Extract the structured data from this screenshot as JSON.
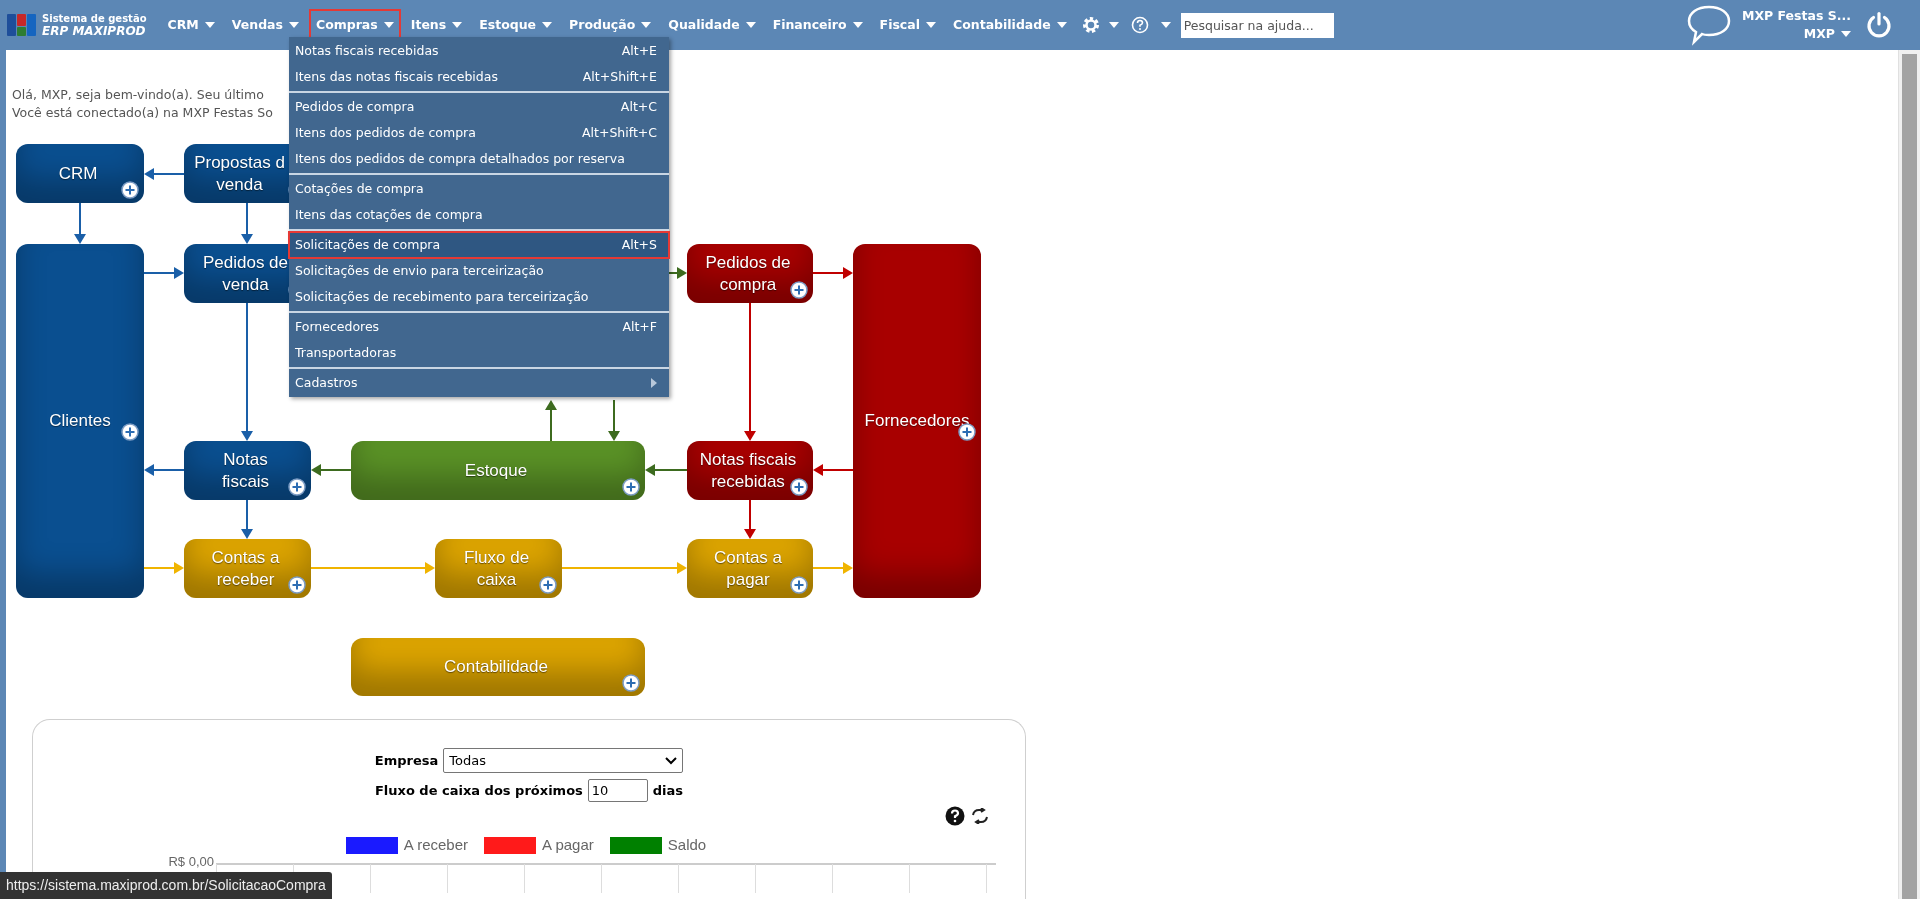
{
  "header": {
    "logo": {
      "line1": "Sistema de gestão",
      "line2": "ERP MAXIPROD"
    },
    "nav": [
      {
        "label": "CRM",
        "selected": false
      },
      {
        "label": "Vendas",
        "selected": false
      },
      {
        "label": "Compras",
        "selected": true
      },
      {
        "label": "Itens",
        "selected": false
      },
      {
        "label": "Estoque",
        "selected": false
      },
      {
        "label": "Produção",
        "selected": false
      },
      {
        "label": "Qualidade",
        "selected": false
      },
      {
        "label": "Financeiro",
        "selected": false
      },
      {
        "label": "Fiscal",
        "selected": false
      },
      {
        "label": "Contabilidade",
        "selected": false
      }
    ],
    "search": {
      "placeholder": "Pesquisar na ajuda..."
    },
    "user": {
      "company": "MXP Festas S...",
      "name": "MXP"
    }
  },
  "menu": {
    "groups": [
      [
        {
          "label": "Notas fiscais recebidas",
          "shortcut": "Alt+E",
          "selected": false,
          "has_submenu": false
        },
        {
          "label": "Itens das notas fiscais recebidas",
          "shortcut": "Alt+Shift+E",
          "selected": false,
          "has_submenu": false
        }
      ],
      [
        {
          "label": "Pedidos de compra",
          "shortcut": "Alt+C",
          "selected": false,
          "has_submenu": false
        },
        {
          "label": "Itens dos pedidos de compra",
          "shortcut": "Alt+Shift+C",
          "selected": false,
          "has_submenu": false
        },
        {
          "label": "Itens dos pedidos de compra detalhados por reserva",
          "selected": false,
          "has_submenu": false
        }
      ],
      [
        {
          "label": "Cotações de compra",
          "selected": false,
          "has_submenu": false
        },
        {
          "label": "Itens das cotações de compra",
          "selected": false,
          "has_submenu": false
        }
      ],
      [
        {
          "label": "Solicitações de compra",
          "shortcut": "Alt+S",
          "selected": true,
          "has_submenu": false
        },
        {
          "label": "Solicitações de envio para terceirização",
          "selected": false,
          "has_submenu": false
        },
        {
          "label": "Solicitações de recebimento para terceirização",
          "selected": false,
          "has_submenu": false
        }
      ],
      [
        {
          "label": "Fornecedores",
          "shortcut": "Alt+F",
          "selected": false,
          "has_submenu": false
        },
        {
          "label": "Transportadoras",
          "selected": false,
          "has_submenu": false
        }
      ],
      [
        {
          "label": "Cadastros",
          "selected": false,
          "has_submenu": true
        }
      ]
    ]
  },
  "greeting": [
    "Olá, MXP, seja bem-vindo(a). Seu último",
    "Você está conectado(a) na MXP Festas So"
  ],
  "diagram": {
    "nodes": [
      {
        "label": "CRM",
        "color": "#0a4f90"
      },
      {
        "label": "Propostas d\nvenda",
        "color": "#0a4f90"
      },
      {
        "label": "Clientes",
        "color": "#0a4f90"
      },
      {
        "label": "Pedidos de\nvenda",
        "color": "#0a4f90"
      },
      {
        "label": "Pedidos de\ncompra",
        "color": "#a80000"
      },
      {
        "label": "Fornecedores",
        "color": "#a80000"
      },
      {
        "label": "Notas\nfiscais",
        "color": "#0a4f90"
      },
      {
        "label": "Estoque",
        "color": "#5a9226"
      },
      {
        "label": "Notas fiscais\nrecebidas",
        "color": "#a80000"
      },
      {
        "label": "Contas a\nreceber",
        "color": "#dca400"
      },
      {
        "label": "Fluxo de\ncaixa",
        "color": "#dca400"
      },
      {
        "label": "Contas a\npagar",
        "color": "#dca400"
      },
      {
        "label": "Contabilidade",
        "color": "#dca400"
      }
    ]
  },
  "cash_flow": {
    "company_label": "Empresa",
    "company_value": "Todas",
    "days_label": "Fluxo de caixa dos próximos",
    "days_value": "10",
    "days_unit": "dias",
    "legend": [
      {
        "label": "A receber",
        "color": "#1a1aff"
      },
      {
        "label": "A pagar",
        "color": "#ff1a1a"
      },
      {
        "label": "Saldo",
        "color": "#008000"
      }
    ],
    "axis_label": "R$ 0,00"
  },
  "status_url": "https://sistema.maxiprod.com.br/SolicitacaoCompra"
}
